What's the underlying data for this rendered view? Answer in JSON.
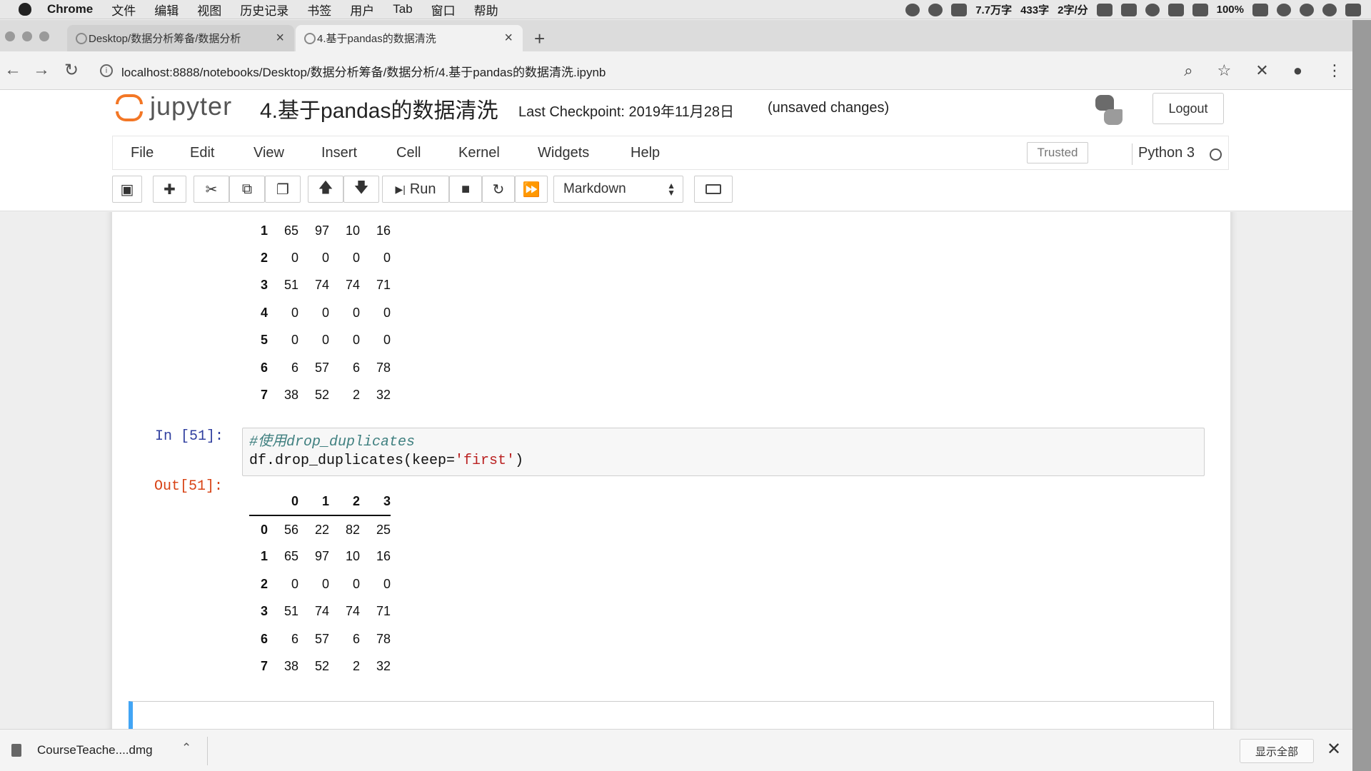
{
  "menubar": {
    "app": "Chrome",
    "items": [
      "文件",
      "编辑",
      "视图",
      "历史记录",
      "书签",
      "用户",
      "Tab",
      "窗口",
      "帮助"
    ],
    "status": [
      "7.7万字",
      "433字",
      "2字/分",
      "100%"
    ]
  },
  "tabs": [
    {
      "label": "Desktop/数据分析筹备/数据分析"
    },
    {
      "label": "4.基于pandas的数据清洗"
    }
  ],
  "address": {
    "url": "localhost:8888/notebooks/Desktop/数据分析筹备/数据分析/4.基于pandas的数据清洗.ipynb"
  },
  "jupyter": {
    "brand": "jupyter",
    "title": "4.基于pandas的数据清洗",
    "checkpoint": "Last Checkpoint: 2019年11月28日",
    "unsaved": "(unsaved changes)",
    "logout": "Logout",
    "menu": [
      "File",
      "Edit",
      "View",
      "Insert",
      "Cell",
      "Kernel",
      "Widgets",
      "Help"
    ],
    "trusted": "Trusted",
    "kernel": "Python 3",
    "toolbar": {
      "run": "Run",
      "celltype": "Markdown"
    }
  },
  "cells": {
    "previous_output": {
      "rows": [
        {
          "idx": "1",
          "vals": [
            "65",
            "97",
            "10",
            "16"
          ]
        },
        {
          "idx": "2",
          "vals": [
            "0",
            "0",
            "0",
            "0"
          ]
        },
        {
          "idx": "3",
          "vals": [
            "51",
            "74",
            "74",
            "71"
          ]
        },
        {
          "idx": "4",
          "vals": [
            "0",
            "0",
            "0",
            "0"
          ]
        },
        {
          "idx": "5",
          "vals": [
            "0",
            "0",
            "0",
            "0"
          ]
        },
        {
          "idx": "6",
          "vals": [
            "6",
            "57",
            "6",
            "78"
          ]
        },
        {
          "idx": "7",
          "vals": [
            "38",
            "52",
            "2",
            "32"
          ]
        }
      ]
    },
    "in_prompt": "In [51]:",
    "code_line1": "#使用drop_duplicates",
    "code_line2_a": "df.drop_duplicates(keep=",
    "code_line2_str": "'first'",
    "code_line2_b": ")",
    "out_prompt": "Out[51]:",
    "output": {
      "columns": [
        "0",
        "1",
        "2",
        "3"
      ],
      "rows": [
        {
          "idx": "0",
          "vals": [
            "56",
            "22",
            "82",
            "25"
          ]
        },
        {
          "idx": "1",
          "vals": [
            "65",
            "97",
            "10",
            "16"
          ]
        },
        {
          "idx": "2",
          "vals": [
            "0",
            "0",
            "0",
            "0"
          ]
        },
        {
          "idx": "3",
          "vals": [
            "51",
            "74",
            "74",
            "71"
          ]
        },
        {
          "idx": "6",
          "vals": [
            "6",
            "57",
            "6",
            "78"
          ]
        },
        {
          "idx": "7",
          "vals": [
            "38",
            "52",
            "2",
            "32"
          ]
        }
      ]
    }
  },
  "download": {
    "filename": "CourseTeache....dmg",
    "show_all": "显示全部"
  }
}
